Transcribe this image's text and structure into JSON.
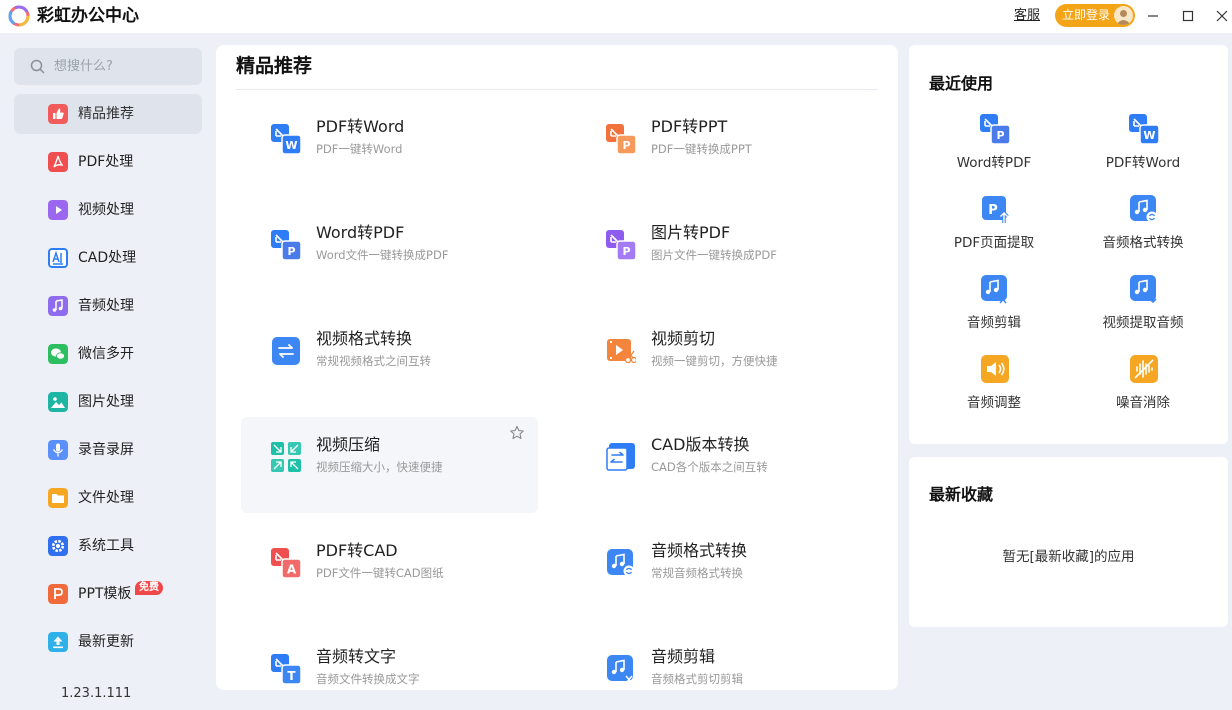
{
  "app": {
    "title": "彩虹办公中心",
    "kefu": "客服",
    "login": "立即登录",
    "version": "1.23.1.111"
  },
  "search": {
    "placeholder": "想搜什么?"
  },
  "colors": {
    "accent": "#2f7df6",
    "login": "#f3a417",
    "badge": "#f04848",
    "bg": "#edf1f7"
  },
  "sidebar": {
    "items": [
      {
        "label": "精品推荐",
        "icon": "thumbs-up-icon",
        "active": true
      },
      {
        "label": "PDF处理",
        "icon": "pdf-icon"
      },
      {
        "label": "视频处理",
        "icon": "video-play-icon"
      },
      {
        "label": "CAD处理",
        "icon": "cad-icon"
      },
      {
        "label": "音频处理",
        "icon": "music-note-icon"
      },
      {
        "label": "微信多开",
        "icon": "wechat-icon"
      },
      {
        "label": "图片处理",
        "icon": "image-icon"
      },
      {
        "label": "录音录屏",
        "icon": "microphone-icon"
      },
      {
        "label": "文件处理",
        "icon": "folder-icon"
      },
      {
        "label": "系统工具",
        "icon": "gear-icon"
      },
      {
        "label": "PPT模板",
        "icon": "ppt-icon",
        "badge": "免费"
      },
      {
        "label": "最新更新",
        "icon": "upload-icon"
      }
    ]
  },
  "main": {
    "title": "精品推荐",
    "cards": [
      {
        "title": "PDF转Word",
        "desc": "PDF一键转Word",
        "icon": "pdf-to-word-icon"
      },
      {
        "title": "PDF转PPT",
        "desc": "PDF一键转换成PPT",
        "icon": "pdf-to-ppt-icon"
      },
      {
        "title": "Word转PDF",
        "desc": "Word文件一键转换成PDF",
        "icon": "word-to-pdf-icon"
      },
      {
        "title": "图片转PDF",
        "desc": "图片文件一键转换成PDF",
        "icon": "image-to-pdf-icon"
      },
      {
        "title": "视频格式转换",
        "desc": "常规视频格式之间互转",
        "icon": "swap-arrows-icon"
      },
      {
        "title": "视频剪切",
        "desc": "视频一键剪切，方便快捷",
        "icon": "video-cut-icon"
      },
      {
        "title": "视频压缩",
        "desc": "视频压缩大小，快速便捷",
        "icon": "compress-icon"
      },
      {
        "title": "CAD版本转换",
        "desc": "CAD各个版本之间互转",
        "icon": "cad-convert-icon"
      },
      {
        "title": "PDF转CAD",
        "desc": "PDF文件一键转CAD图纸",
        "icon": "pdf-to-cad-icon"
      },
      {
        "title": "音频格式转换",
        "desc": "常规音频格式转换",
        "icon": "audio-convert-icon"
      },
      {
        "title": "音频转文字",
        "desc": "音频文件转换成文字",
        "icon": "audio-to-text-icon"
      },
      {
        "title": "音频剪辑",
        "desc": "音频格式剪切剪辑",
        "icon": "audio-cut-icon"
      }
    ]
  },
  "recent": {
    "title": "最近使用",
    "items": [
      {
        "label": "Word转PDF",
        "icon": "word-to-pdf-icon"
      },
      {
        "label": "PDF转Word",
        "icon": "pdf-to-word-icon"
      },
      {
        "label": "PDF页面提取",
        "icon": "pdf-extract-icon"
      },
      {
        "label": "音频格式转换",
        "icon": "audio-convert-icon"
      },
      {
        "label": "音频剪辑",
        "icon": "audio-cut-icon"
      },
      {
        "label": "视频提取音频",
        "icon": "video-extract-audio-icon"
      },
      {
        "label": "音频调整",
        "icon": "volume-icon"
      },
      {
        "label": "噪音消除",
        "icon": "noise-cancel-icon"
      }
    ]
  },
  "favorites": {
    "title": "最新收藏",
    "empty": "暂无[最新收藏]的应用"
  }
}
